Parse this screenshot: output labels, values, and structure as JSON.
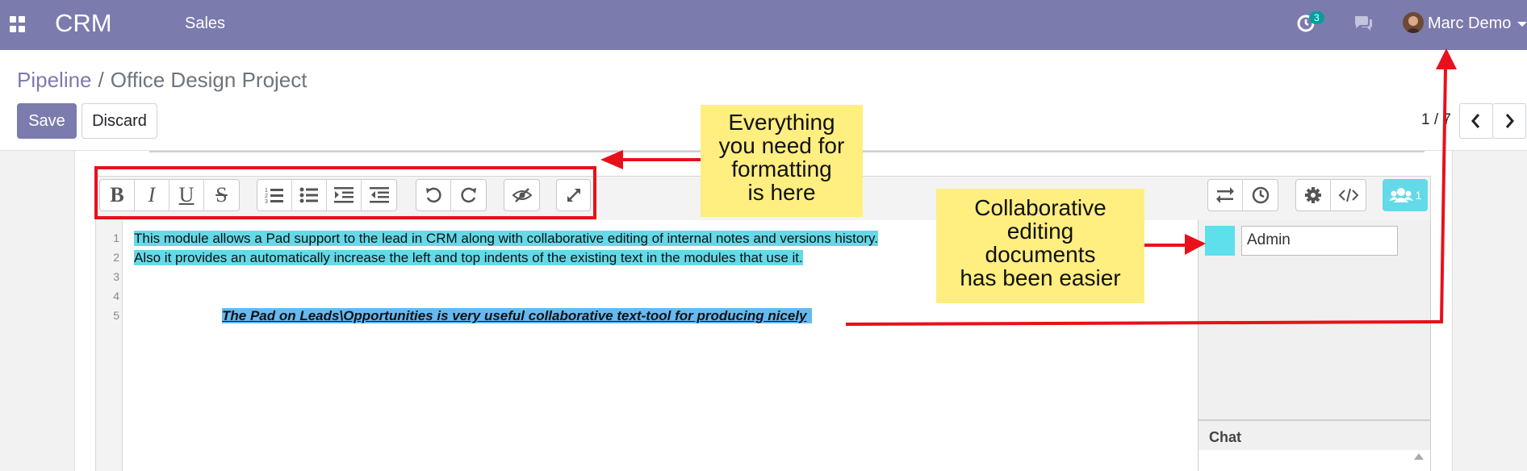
{
  "navbar": {
    "app_name": "CRM",
    "menu": [
      "Sales"
    ],
    "activity_count": "3",
    "user_name": "Marc Demo"
  },
  "breadcrumb": {
    "parent": "Pipeline",
    "separator": "/",
    "current": "Office Design Project"
  },
  "buttons": {
    "save": "Save",
    "discard": "Discard"
  },
  "pager": {
    "value": "1 / 7"
  },
  "pad": {
    "toolbar_icons": [
      "bold-icon",
      "italic-icon",
      "underline-icon",
      "strikethrough-icon",
      "ordered-list-icon",
      "unordered-list-icon",
      "indent-icon",
      "outdent-icon",
      "undo-icon",
      "redo-icon",
      "clear-authorship-icon",
      "fullscreen-icon",
      "import-export-icon",
      "timeslider-icon",
      "settings-icon",
      "embed-icon",
      "users-icon"
    ],
    "users_count": "1",
    "line_numbers": [
      "1",
      "2",
      "3",
      "4",
      "5"
    ],
    "lines": [
      "This module allows a Pad support to the lead in CRM along with collaborative editing of internal notes and versions history.",
      "Also it provides an automatically increase the left and top indents of the existing text in the modules that use it.",
      "",
      "",
      "The Pad on Leads\\Opportunities is very useful collaborative text-tool for producing nicely"
    ],
    "user_label": "Admin",
    "chat_label": "Chat",
    "user_color": "#5ee0ec"
  },
  "annotations": {
    "callout_formatting": [
      "Everything",
      "you need for",
      "formatting",
      "is here"
    ],
    "callout_collab": [
      "Collaborative",
      "editing",
      "documents",
      "has been easier"
    ],
    "arrow_color": "#e8101a",
    "callout_color": "#ffee80"
  },
  "colors": {
    "navbar": "#7c7bad",
    "accent": "#7c7bad",
    "badge": "#00a09d"
  }
}
